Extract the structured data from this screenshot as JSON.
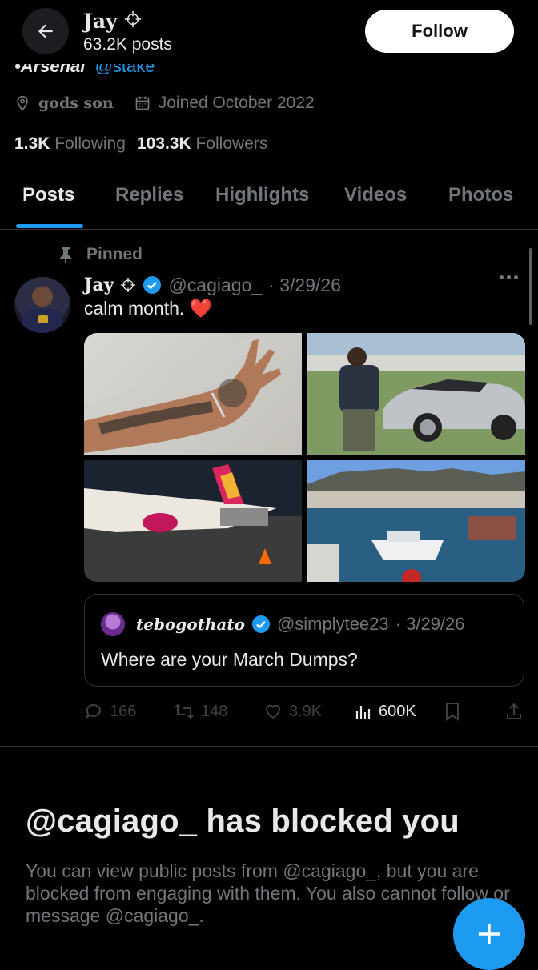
{
  "header": {
    "name": "Jay",
    "posts_count": "63.2K posts",
    "follow_label": "Follow"
  },
  "bio": {
    "tail_text": "•Arsenal",
    "link": "@stake"
  },
  "profile_meta": {
    "location": "gods son",
    "joined": "Joined October 2022"
  },
  "stats": {
    "following_count": "1.3K",
    "following_label": "Following",
    "followers_count": "103.3K",
    "followers_label": "Followers"
  },
  "tabs": [
    {
      "label": "Posts",
      "active": true
    },
    {
      "label": "Replies",
      "active": false
    },
    {
      "label": "Highlights",
      "active": false
    },
    {
      "label": "Videos",
      "active": false
    },
    {
      "label": "Photos",
      "active": false
    }
  ],
  "post": {
    "pinned_label": "Pinned",
    "author_name": "Jay",
    "handle": "@cagiago_",
    "date": "· 3/29/26",
    "text": "calm month. ❤️",
    "quote": {
      "author_name": "tebogothato",
      "handle": "@simplytee23",
      "date": "· 3/29/26",
      "text": "Where are your March Dumps?"
    },
    "actions": {
      "replies": "166",
      "reposts": "148",
      "likes": "3.9K",
      "views": "600K"
    }
  },
  "blocked": {
    "title": "@cagiago_ has blocked you",
    "body": "You can view public posts from @cagiago_, but you are blocked from engaging with them. You also cannot follow or message @cagiago_."
  },
  "colors": {
    "accent": "#1d9bf0",
    "background": "#000000",
    "secondary_text": "#71767b",
    "heart": "#f91880"
  }
}
